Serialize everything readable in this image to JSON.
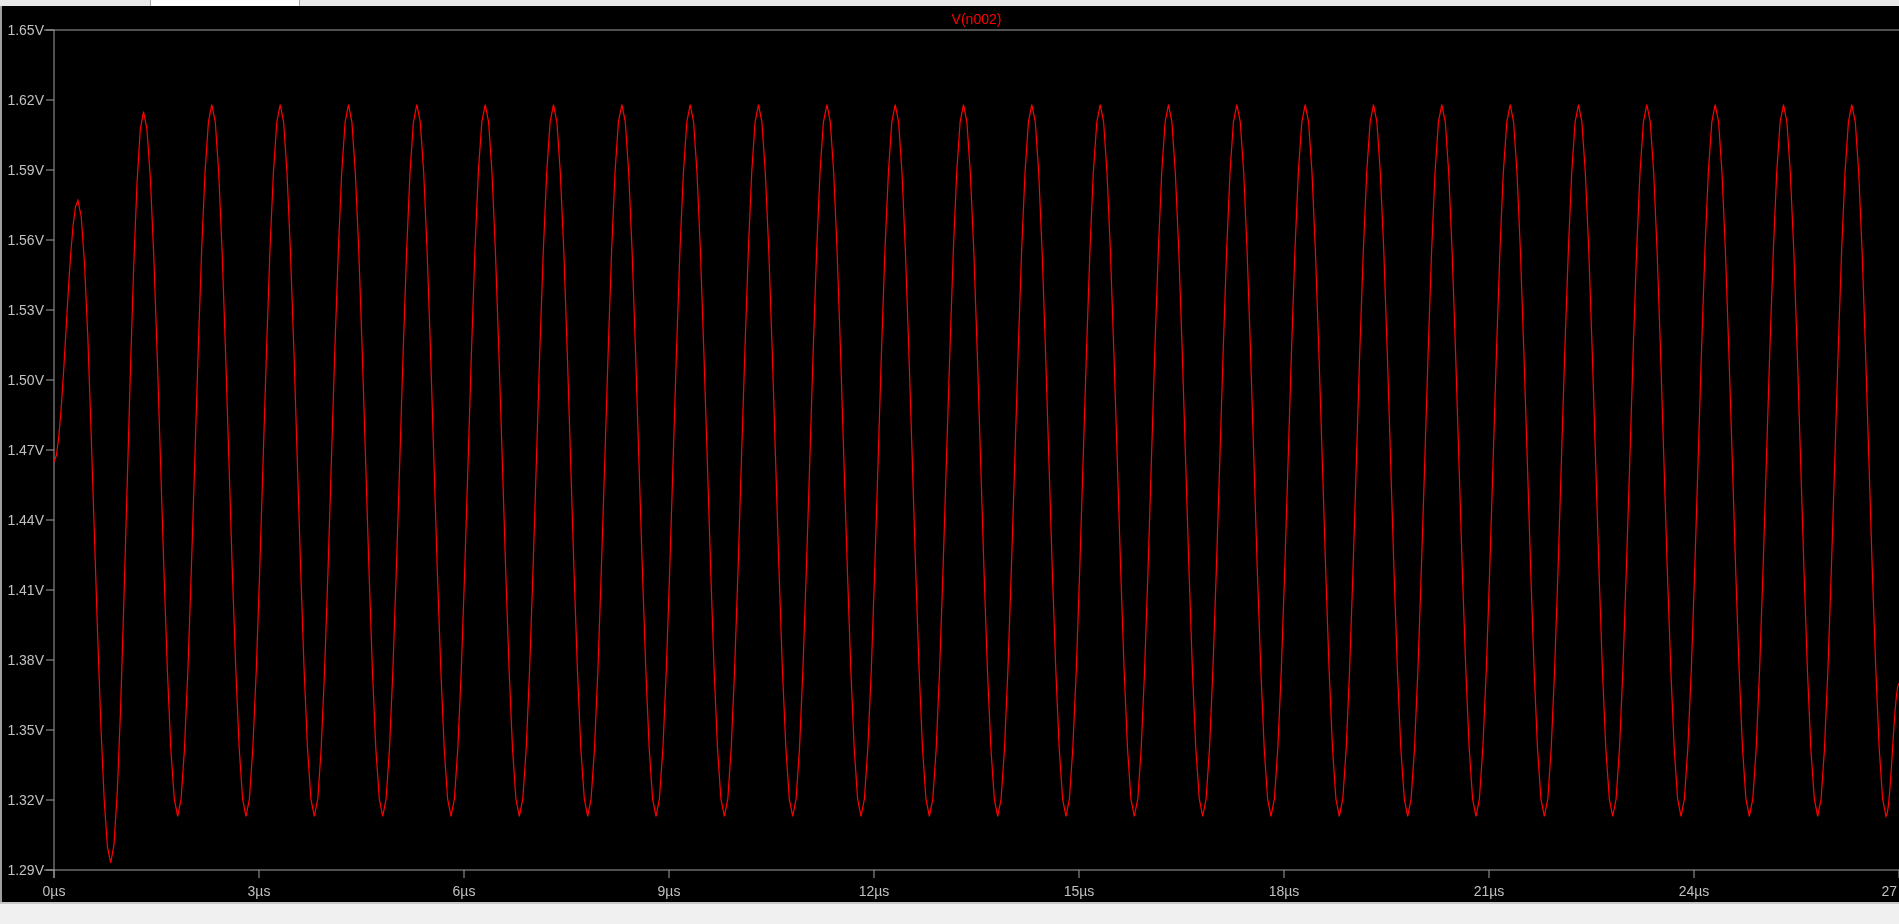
{
  "plot": {
    "chart_data": {
      "type": "line",
      "x": [
        0,
        0.35,
        0.83,
        1.31,
        1.81,
        2.31,
        2.81,
        3.31,
        3.81,
        4.31,
        4.81,
        5.31,
        5.81,
        6.31,
        6.81,
        7.31,
        7.81,
        8.31,
        8.81,
        9.31,
        9.81,
        10.31,
        10.81,
        11.31,
        11.81,
        12.31,
        12.81,
        13.31,
        13.81,
        14.31,
        14.81,
        15.31,
        15.81,
        16.31,
        16.81,
        17.31,
        17.81,
        18.31,
        18.81,
        19.31,
        19.81,
        20.31,
        20.81,
        21.31,
        21.81,
        22.31,
        22.81,
        23.31,
        23.81,
        24.31,
        24.81,
        25.31,
        25.81,
        26.31,
        26.81,
        27
      ],
      "series": [
        {
          "name": "V(n002)",
          "color": "#ff0000",
          "values": [
            1.465,
            1.577,
            1.293,
            1.615,
            1.313,
            1.618,
            1.313,
            1.618,
            1.313,
            1.618,
            1.313,
            1.618,
            1.313,
            1.618,
            1.313,
            1.618,
            1.313,
            1.618,
            1.313,
            1.618,
            1.313,
            1.618,
            1.313,
            1.618,
            1.313,
            1.618,
            1.313,
            1.618,
            1.313,
            1.618,
            1.313,
            1.618,
            1.313,
            1.618,
            1.313,
            1.618,
            1.313,
            1.618,
            1.313,
            1.618,
            1.313,
            1.618,
            1.313,
            1.618,
            1.313,
            1.618,
            1.313,
            1.618,
            1.313,
            1.618,
            1.313,
            1.618,
            1.313,
            1.618,
            1.313,
            1.37
          ]
        }
      ],
      "xlim": [
        0,
        27
      ],
      "ylim": [
        1.29,
        1.65
      ],
      "xticks": [
        {
          "value": 0,
          "label": "0µs"
        },
        {
          "value": 3,
          "label": "3µs"
        },
        {
          "value": 6,
          "label": "6µs"
        },
        {
          "value": 9,
          "label": "9µs"
        },
        {
          "value": 12,
          "label": "12µs"
        },
        {
          "value": 15,
          "label": "15µs"
        },
        {
          "value": 18,
          "label": "18µs"
        },
        {
          "value": 21,
          "label": "21µs"
        },
        {
          "value": 24,
          "label": "24µs"
        },
        {
          "value": 27,
          "label": "27"
        }
      ],
      "yticks": [
        {
          "value": 1.65,
          "label": "1.65V"
        },
        {
          "value": 1.62,
          "label": "1.62V"
        },
        {
          "value": 1.59,
          "label": "1.59V"
        },
        {
          "value": 1.56,
          "label": "1.56V"
        },
        {
          "value": 1.53,
          "label": "1.53V"
        },
        {
          "value": 1.5,
          "label": "1.50V"
        },
        {
          "value": 1.47,
          "label": "1.47V"
        },
        {
          "value": 1.44,
          "label": "1.44V"
        },
        {
          "value": 1.41,
          "label": "1.41V"
        },
        {
          "value": 1.38,
          "label": "1.38V"
        },
        {
          "value": 1.35,
          "label": "1.35V"
        },
        {
          "value": 1.32,
          "label": "1.32V"
        },
        {
          "value": 1.29,
          "label": "1.29V"
        }
      ]
    }
  }
}
